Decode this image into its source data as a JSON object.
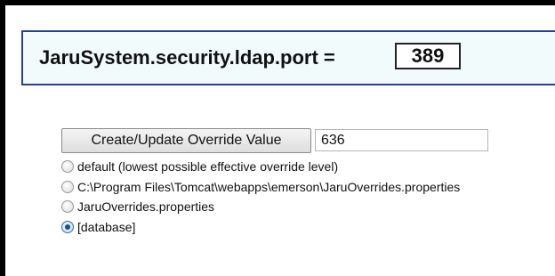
{
  "header": {
    "property_name": "JaruSystem.security.ldap.port =",
    "current_value": "389"
  },
  "override": {
    "button_label": "Create/Update Override Value",
    "input_value": "636"
  },
  "radio_options": [
    {
      "label": "default (lowest possible effective override level)",
      "checked": false
    },
    {
      "label": "C:\\Program Files\\Tomcat\\webapps\\emerson\\JaruOverrides.properties",
      "checked": false
    },
    {
      "label": "JaruOverrides.properties",
      "checked": false
    },
    {
      "label": "[database]",
      "checked": true
    }
  ],
  "colors": {
    "panel_background": "#f2fbfc",
    "panel_border": "#2b3f8f"
  }
}
